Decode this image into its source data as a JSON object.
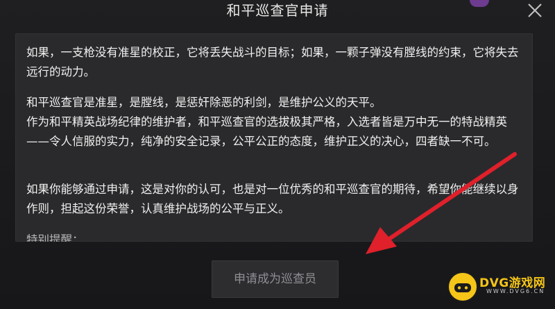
{
  "dialog": {
    "title": "和平巡查官申请",
    "paragraphs": [
      "如果，一支枪没有准星的校正，它将丢失战斗的目标；如果，一颗子弹没有膛线的约束，它将失去远行的动力。",
      "和平巡查官是准星，是膛线，是惩奸除恶的利剑，是维护公义的天平。\n作为和平精英战场纪律的维护者，和平巡查官的选拔极其严格，入选者皆是万中无一的特战精英——令人信服的实力，纯净的安全记录，公平公正的态度，维护正义的决心，四者缺一不可。",
      "如果你能够通过申请，这是对你的认可，也是对一位优秀的和平巡查官的期待，希望你能继续以身作则，担起这份荣誉，认真维护战场的公平与正义。",
      "特别提醒："
    ],
    "apply_button": "申请成为巡查员"
  },
  "watermark": {
    "brand": "DVG游戏网",
    "url": "WWW.DVG6.CN"
  },
  "colors": {
    "arrow": "#e0202a",
    "brand_yellow": "#f5c518"
  },
  "icons": [
    "close-icon",
    "annotation-arrow",
    "logo-icon"
  ]
}
